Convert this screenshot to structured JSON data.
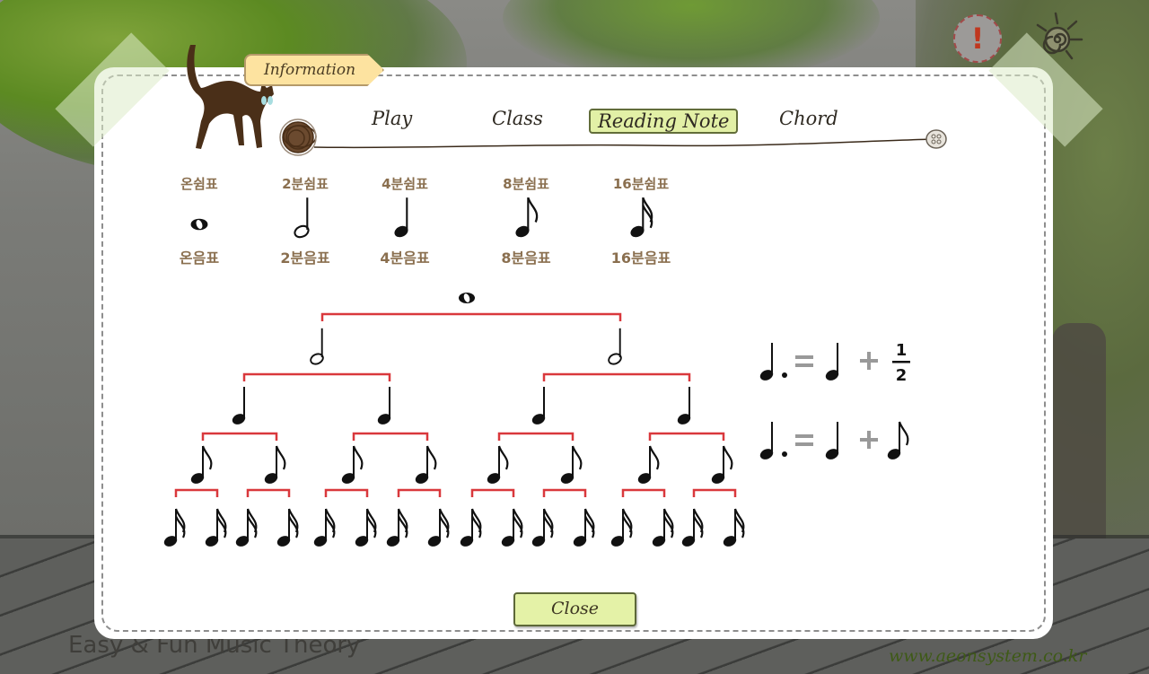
{
  "app": {
    "footer_title": "Easy & Fun Music Theory",
    "footer_url": "www.aeonsystem.co.kr"
  },
  "dialog": {
    "title_tab": "Information",
    "tabs": [
      {
        "label": "Play",
        "active": false
      },
      {
        "label": "Class",
        "active": false
      },
      {
        "label": "Reading Note",
        "active": true
      },
      {
        "label": "Chord",
        "active": false
      }
    ],
    "close_label": "Close"
  },
  "notes": [
    {
      "top_label": "온쉼표",
      "bottom_label": "온음표",
      "type": "whole"
    },
    {
      "top_label": "2분쉼표",
      "bottom_label": "2분음표",
      "type": "half"
    },
    {
      "top_label": "4분쉼표",
      "bottom_label": "4분음표",
      "type": "quarter"
    },
    {
      "top_label": "8분쉼표",
      "bottom_label": "8분음표",
      "type": "eighth"
    },
    {
      "top_label": "16분쉼표",
      "bottom_label": "16분음표",
      "type": "sixteenth"
    }
  ],
  "tree": {
    "levels": [
      "whole",
      "half",
      "quarter",
      "eighth",
      "sixteenth"
    ],
    "bracket_color": "#d9383c"
  },
  "equations": [
    {
      "left": "dotted-quarter",
      "equals": "=",
      "first": "quarter",
      "plus": "+",
      "second": "1/2"
    },
    {
      "left": "dotted-quarter",
      "equals": "=",
      "first": "quarter",
      "plus": "+",
      "second": "eighth"
    }
  ],
  "fraction": {
    "numerator": "1",
    "denominator": "2"
  },
  "icons": {
    "alert": "!",
    "settings": "sun-spiral-icon"
  },
  "colors": {
    "accent_tab": "#e2f0a6",
    "info_tab": "#fde3a0",
    "label_brown": "#8a6f4f",
    "bracket_red": "#d9383c"
  }
}
